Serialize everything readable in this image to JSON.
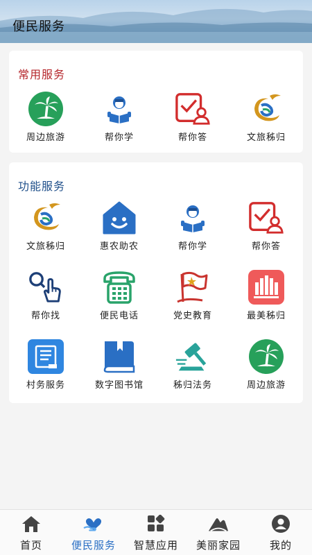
{
  "header": {
    "title": "便民服务"
  },
  "common": {
    "title": "常用服务",
    "items": [
      {
        "label": "周边旅游",
        "icon": "palm-tree-icon"
      },
      {
        "label": "帮你学",
        "icon": "student-reading-icon"
      },
      {
        "label": "帮你答",
        "icon": "checklist-user-icon"
      },
      {
        "label": "文旅秭归",
        "icon": "culture-tourism-logo-icon"
      }
    ]
  },
  "functions": {
    "title": "功能服务",
    "items": [
      {
        "label": "文旅秭归",
        "icon": "culture-tourism-logo-icon"
      },
      {
        "label": "惠农助农",
        "icon": "smiling-house-icon"
      },
      {
        "label": "帮你学",
        "icon": "student-reading-icon"
      },
      {
        "label": "帮你答",
        "icon": "checklist-user-icon"
      },
      {
        "label": "帮你找",
        "icon": "search-hand-icon"
      },
      {
        "label": "便民电话",
        "icon": "telephone-icon"
      },
      {
        "label": "党史教育",
        "icon": "party-flag-icon"
      },
      {
        "label": "最美秭归",
        "icon": "city-buildings-icon"
      },
      {
        "label": "村务服务",
        "icon": "document-scroll-icon"
      },
      {
        "label": "数字图书馆",
        "icon": "book-icon"
      },
      {
        "label": "秭归法务",
        "icon": "gavel-icon"
      },
      {
        "label": "周边旅游",
        "icon": "palm-tree-icon"
      }
    ]
  },
  "tabbar": {
    "active": 1,
    "tabs": [
      {
        "label": "首页",
        "icon": "home-icon"
      },
      {
        "label": "便民服务",
        "icon": "heart-hands-icon"
      },
      {
        "label": "智慧应用",
        "icon": "apps-grid-icon"
      },
      {
        "label": "美丽家园",
        "icon": "mountain-icon"
      },
      {
        "label": "我的",
        "icon": "user-avatar-icon"
      }
    ]
  },
  "colors": {
    "accent": "#2a6fc4",
    "common_title": "#b5262b",
    "function_title": "#1f4f8a"
  }
}
